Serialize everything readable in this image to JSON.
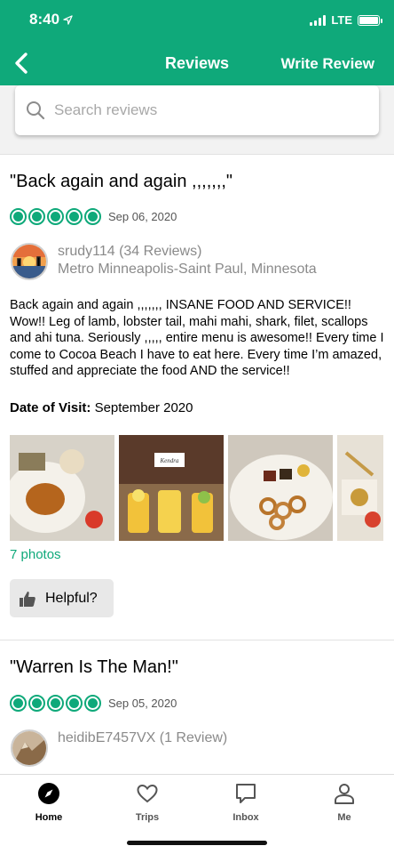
{
  "status": {
    "time": "8:40",
    "network": "LTE"
  },
  "nav": {
    "title": "Reviews",
    "write_review": "Write Review"
  },
  "search": {
    "placeholder": "Search reviews"
  },
  "reviews": [
    {
      "title": "\"Back again and again ,,,,,,,\"",
      "bubbles": 5,
      "date": "Sep 06, 2020",
      "user": "srudy114 (34 Reviews)",
      "location": "Metro Minneapolis-Saint Paul, Minnesota",
      "text": "Back again and again ,,,,,,, INSANE FOOD AND SERVICE!! Wow!!   Leg of lamb, lobster tail, mahi mahi, shark, filet, scallops and ahi tuna.  Seriously ,,,,, entire menu is awesome!!  Every time I come to Cocoa Beach I have to eat here.  Every time I’m amazed, stuffed and appreciate the food AND the service!!",
      "visit_label": "Date of Visit:",
      "visit_value": "September 2020",
      "photos_link": "7 photos",
      "photo_sign": "Kendra",
      "helpful": "Helpful?"
    },
    {
      "title": "\"Warren Is The Man!\"",
      "bubbles": 5,
      "date": "Sep 05, 2020",
      "user": "heidibE7457VX (1 Review)"
    }
  ],
  "tabs": [
    {
      "label": "Home",
      "icon": "compass-icon"
    },
    {
      "label": "Trips",
      "icon": "heart-icon"
    },
    {
      "label": "Inbox",
      "icon": "chat-icon"
    },
    {
      "label": "Me",
      "icon": "person-icon"
    }
  ],
  "colors": {
    "brand": "#0fa97a"
  }
}
